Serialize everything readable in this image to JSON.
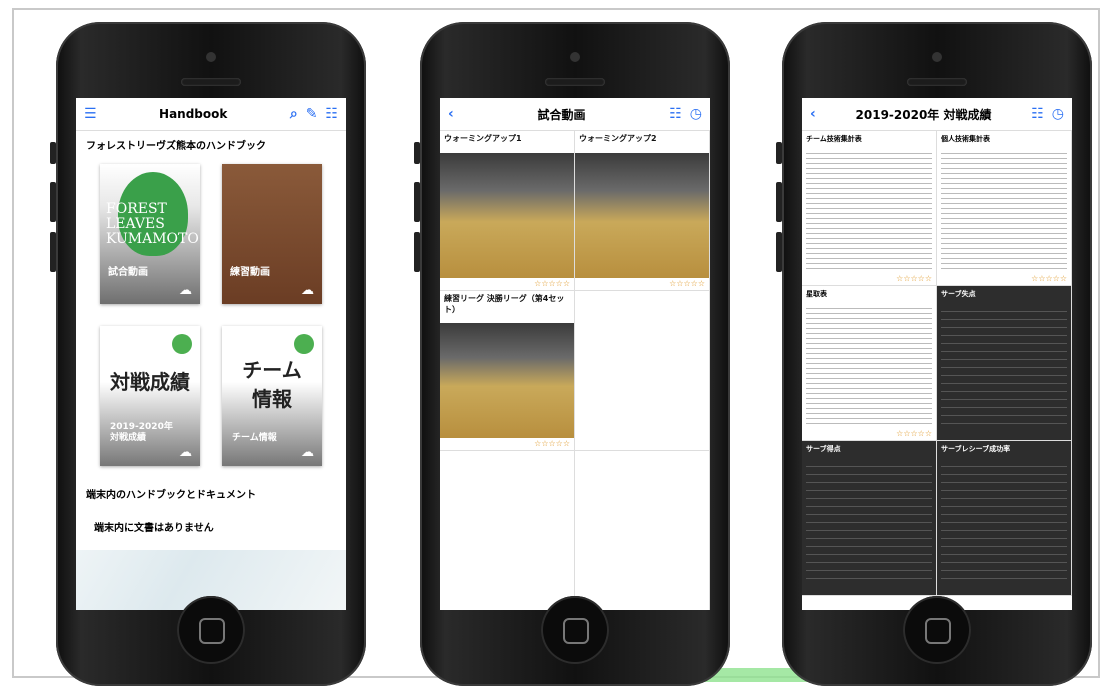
{
  "phone1": {
    "title": "Handbook",
    "section_title": "フォレストリーヴズ熊本のハンドブック",
    "tiles": [
      {
        "label": "試合動画",
        "logo": "FOREST LEAVES KUMAMOTO"
      },
      {
        "label": "練習動画"
      },
      {
        "big": "対戦成績",
        "label": "2019-2020年\n対戦成績"
      },
      {
        "big": "チーム\n情報",
        "label": "チーム情報"
      }
    ],
    "device_section": "端末内のハンドブックとドキュメント",
    "empty_message": "端末内に文書はありません"
  },
  "phone2": {
    "title": "試合動画",
    "videos": [
      {
        "title": "ウォーミングアップ1",
        "stars": "☆☆☆☆☆"
      },
      {
        "title": "ウォーミングアップ2",
        "stars": "☆☆☆☆☆"
      },
      {
        "title": "練習リーグ 決勝リーグ（第4セット）",
        "stars": "☆☆☆☆☆"
      }
    ]
  },
  "phone3": {
    "title": "2019-2020年 対戦成績",
    "docs": [
      {
        "title": "チーム技術集計表",
        "dark": false,
        "stars": "☆☆☆☆☆"
      },
      {
        "title": "個人技術集計表",
        "dark": false,
        "stars": "☆☆☆☆☆"
      },
      {
        "title": "星取表",
        "dark": false,
        "stars": "☆☆☆☆☆"
      },
      {
        "title": "サーブ失点",
        "dark": true,
        "stars": ""
      },
      {
        "title": "サーブ得点",
        "dark": true,
        "stars": ""
      },
      {
        "title": "サーブレシーブ成功率",
        "dark": true,
        "stars": ""
      }
    ]
  }
}
